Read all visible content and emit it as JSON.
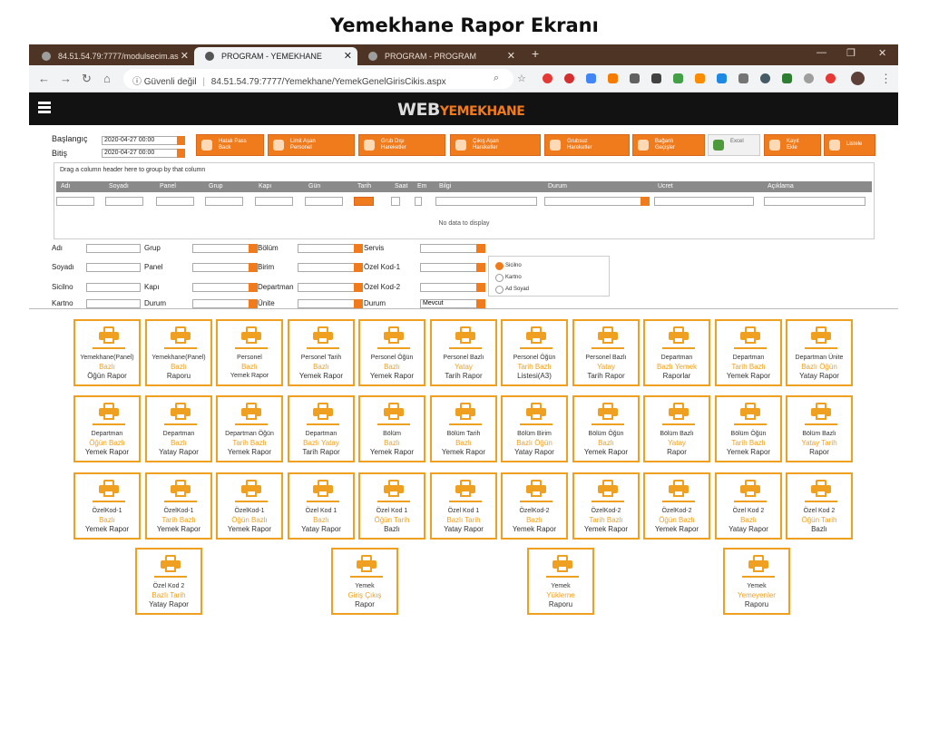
{
  "page_title": "Yemekhane Rapor Ekranı",
  "browser": {
    "tabs": [
      {
        "title": "84.51.54.79:7777/modulsecim.as"
      },
      {
        "title": "PROGRAM - YEMEKHANE"
      },
      {
        "title": "PROGRAM - PROGRAM"
      }
    ],
    "security": "Güvenli değil",
    "url": "84.51.54.79:7777/Yemekhane/YemekGenelGirisCikis.aspx"
  },
  "app": {
    "logo_web": "WEB",
    "logo_name": "YEMEKHANE"
  },
  "dates": {
    "start_label": "Başlangıç",
    "start_value": "2020-04-27 00:00",
    "end_label": "Bitiş",
    "end_value": "2020-04-27 00:00"
  },
  "toolbar": [
    {
      "l1": "Hatalı Pass",
      "l2": "Back"
    },
    {
      "l1": "Limit Aşan",
      "l2": "Personel"
    },
    {
      "l1": "Grub Dışı",
      "l2": "Hareketler"
    },
    {
      "l1": "Çıkış Aşan",
      "l2": "Hareketler"
    },
    {
      "l1": "Grubsuz",
      "l2": "Hareketler"
    },
    {
      "l1": "Bağanlı",
      "l2": "Geçişler"
    },
    {
      "l1": "Excel",
      "l2": ""
    },
    {
      "l1": "Kayıt",
      "l2": "Ekle"
    },
    {
      "l1": "Listele",
      "l2": ""
    }
  ],
  "grid": {
    "group_hint": "Drag a column header here to group by that column",
    "columns": [
      "Adı",
      "Soyadı",
      "Panel",
      "Grup",
      "Kapı",
      "Gün",
      "Tarih",
      "Saat",
      "Em",
      "Bilgi",
      "Durum",
      "Ucret",
      "Açıklama"
    ],
    "empty": "No data to display"
  },
  "filters": {
    "adi": "Adı",
    "soyadi": "Soyadı",
    "sicilno": "Sicilno",
    "kartno": "Kartno",
    "grup": "Grup",
    "panel": "Panel",
    "kapi": "Kapı",
    "durum": "Durum",
    "bolum": "Bölüm",
    "birim": "Birim",
    "departman": "Departman",
    "unite": "Ünite",
    "servis": "Servis",
    "ozel1": "Özel Kod-1",
    "ozel2": "Özel Kod-2",
    "durum2": "Durum",
    "durum2_value": "Mevcut"
  },
  "sort": {
    "options": [
      "Sicilno",
      "Kartno",
      "Ad Soyad"
    ],
    "selected": "Sicilno"
  },
  "reports": [
    {
      "l1": "Yemekhane(Panel)",
      "l2": "Bazlı",
      "l3": "Öğün Rapor"
    },
    {
      "l1": "Yemekhane(Panel)",
      "l2": "Bazlı",
      "l3": "Raporu"
    },
    {
      "l1": "Personel",
      "l2": "Bazlı",
      "l3": "Yemek Rapor"
    },
    {
      "l1": "Personel Tarih",
      "l2": "Bazlı",
      "l3": "Yemek Rapor"
    },
    {
      "l1": "Personel Öğün",
      "l2": "Bazlı",
      "l3": "Yemek Rapor"
    },
    {
      "l1": "Personel Bazlı",
      "l2": "Yatay",
      "l3": "Tarih Rapor"
    },
    {
      "l1": "Personel Öğün",
      "l2": "Tarih Bazlı",
      "l3": "Listesi(A3)"
    },
    {
      "l1": "Personel Bazlı",
      "l2": "Yatay",
      "l3": "Tarih Rapor"
    },
    {
      "l1": "Departman",
      "l2": "Bazlı Yemek",
      "l3": "Raporlar"
    },
    {
      "l1": "Departman",
      "l2": "Tarih Bazlı",
      "l3": "Yemek Rapor"
    },
    {
      "l1": "Departman Ünite",
      "l2": "Bazlı Öğün",
      "l3": "Yatay Rapor"
    },
    {
      "l1": "Departman",
      "l2": "Öğün Bazlı",
      "l3": "Yemek Rapor"
    },
    {
      "l1": "Departman",
      "l2": "Bazlı",
      "l3": "Yatay Rapor"
    },
    {
      "l1": "Departman Öğün",
      "l2": "Tarih Bazlı",
      "l3": "Yemek Rapor"
    },
    {
      "l1": "Departman",
      "l2": "Bazlı Yatay",
      "l3": "Tarih Rapor"
    },
    {
      "l1": "Bölüm",
      "l2": "Bazlı",
      "l3": "Yemek Rapor"
    },
    {
      "l1": "Bölüm Tarih",
      "l2": "Bazlı",
      "l3": "Yemek Rapor"
    },
    {
      "l1": "Bölüm Birim",
      "l2": "Bazlı Öğün",
      "l3": "Yatay Rapor"
    },
    {
      "l1": "Bölüm Öğün",
      "l2": "Bazlı",
      "l3": "Yemek Rapor"
    },
    {
      "l1": "Bölüm Bazlı",
      "l2": "Yatay",
      "l3": "Rapor"
    },
    {
      "l1": "Bölüm Öğün",
      "l2": "Tarih Bazlı",
      "l3": "Yemek Rapor"
    },
    {
      "l1": "Bölüm Bazlı",
      "l2": "Yatay Tarih",
      "l3": "Rapor"
    },
    {
      "l1": "ÖzelKod-1",
      "l2": "Bazlı",
      "l3": "Yemek Rapor"
    },
    {
      "l1": "ÖzelKod-1",
      "l2": "Tarih Bazlı",
      "l3": "Yemek Rapor"
    },
    {
      "l1": "ÖzelKod-1",
      "l2": "Öğün Bazlı",
      "l3": "Yemek Rapor"
    },
    {
      "l1": "Özel Kod 1",
      "l2": "Bazlı",
      "l3": "Yatay Rapor"
    },
    {
      "l1": "Özel Kod 1",
      "l2": "Öğün Tarih",
      "l3": "Bazlı"
    },
    {
      "l1": "Özel Kod 1",
      "l2": "Bazlı Tarih",
      "l3": "Yatay Rapor"
    },
    {
      "l1": "ÖzelKod-2",
      "l2": "Bazlı",
      "l3": "Yemek Rapor"
    },
    {
      "l1": "ÖzelKod-2",
      "l2": "Tarih Bazlı",
      "l3": "Yemek Rapor"
    },
    {
      "l1": "ÖzelKod-2",
      "l2": "Öğün Bazlı",
      "l3": "Yemek Rapor"
    },
    {
      "l1": "Özel Kod 2",
      "l2": "Bazlı",
      "l3": "Yatay Rapor"
    },
    {
      "l1": "Özel Kod 2",
      "l2": "Öğün Tarih",
      "l3": "Bazlı"
    },
    {
      "l1": "Özel Kod 2",
      "l2": "Bazlı Tarih",
      "l3": "Yatay Rapor"
    },
    {
      "l1": "Yemek",
      "l2": "Giriş Çıkış",
      "l3": "Rapor"
    },
    {
      "l1": "Yemek",
      "l2": "Yüklerne",
      "l3": "Raporu"
    },
    {
      "l1": "Yemek",
      "l2": "Yemeyenler",
      "l3": "Raporu"
    }
  ]
}
